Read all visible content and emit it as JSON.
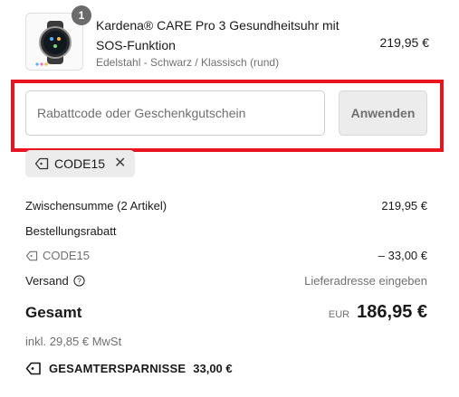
{
  "product": {
    "quantity": "1",
    "title": "Kardena® CARE Pro 3 Gesundheitsuhr mit SOS-Funktion",
    "variant": "Edelstahl - Schwarz / Klassisch (rund)",
    "price": "219,95 €",
    "thumbnail_icon": "smartwatch-icon"
  },
  "discount": {
    "placeholder": "Rabattcode oder Geschenkgutschein",
    "value": "",
    "apply_label": "Anwenden",
    "applied_code": "CODE15",
    "highlight_color": "#e8141f"
  },
  "summary": {
    "subtotal_label": "Zwischensumme (2 Artikel)",
    "subtotal_value": "219,95 €",
    "order_discount_label": "Bestellungsrabatt",
    "discount_code": "CODE15",
    "discount_value": "– 33,00 €",
    "shipping_label": "Versand",
    "shipping_value": "Lieferadresse eingeben",
    "total_label": "Gesamt",
    "currency": "EUR",
    "total_value": "186,95 €",
    "tax_note": "inkl. 29,85 € MwSt",
    "savings_label": "GESAMTERSPARNISSE",
    "savings_value": "33,00 €"
  }
}
